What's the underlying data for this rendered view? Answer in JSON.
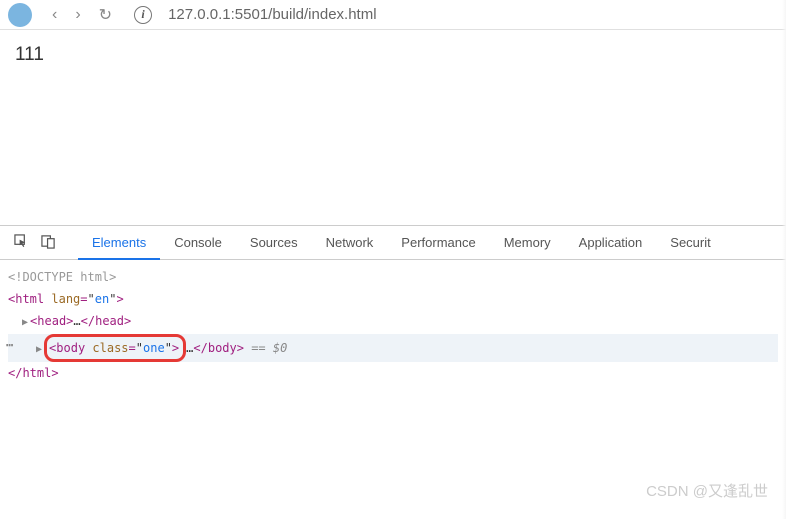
{
  "browser": {
    "url": "127.0.0.1:5501/build/index.html"
  },
  "page": {
    "content": "111"
  },
  "devtools": {
    "tabs": {
      "elements": "Elements",
      "console": "Console",
      "sources": "Sources",
      "network": "Network",
      "performance": "Performance",
      "memory": "Memory",
      "application": "Application",
      "security": "Securit"
    },
    "dom": {
      "doctype": "<!DOCTYPE html>",
      "html_open_tag": "html",
      "html_attr_name": "lang",
      "html_attr_val": "en",
      "head_open": "head",
      "head_ellipsis": "…",
      "head_close": "head",
      "body_open": "body",
      "body_attr_name": "class",
      "body_attr_val": "one",
      "body_ellipsis": "…",
      "body_close": "body",
      "selected_suffix": " == $0",
      "html_close": "html"
    }
  },
  "watermark": "CSDN @又逢乱世"
}
